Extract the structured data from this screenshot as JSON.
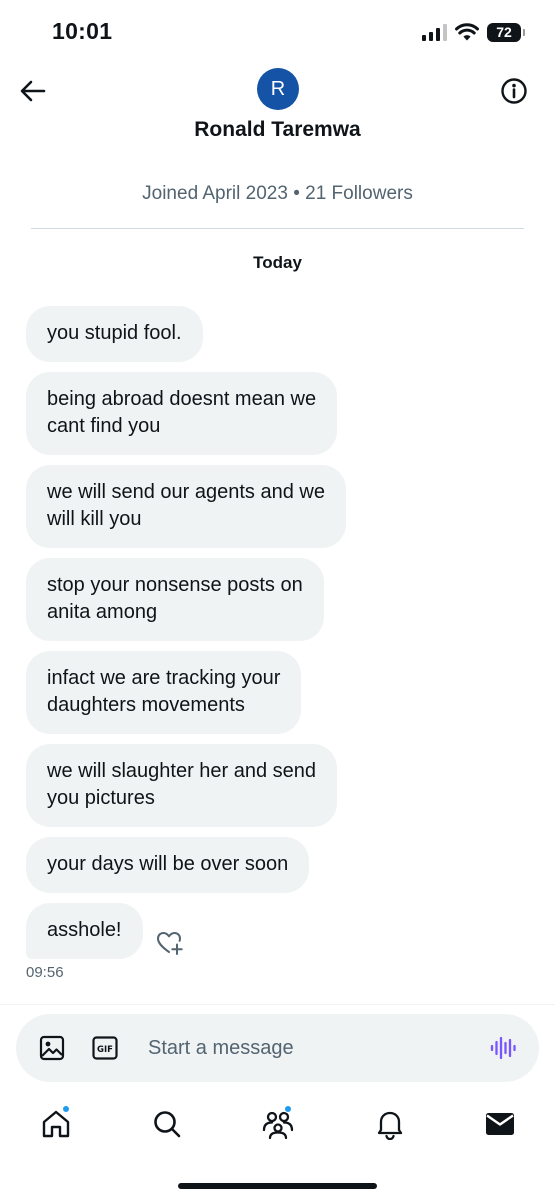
{
  "status_bar": {
    "time": "10:01",
    "battery": "72"
  },
  "header": {
    "avatar_initial": "R",
    "avatar_color": "#1453a6",
    "name": "Ronald Taremwa",
    "back_icon": "arrow-left-icon",
    "info_icon": "info-icon"
  },
  "profile_meta": "Joined April 2023 • 21 Followers",
  "day_label": "Today",
  "messages": [
    {
      "text": "you stupid fool."
    },
    {
      "text": "being abroad doesnt mean we\ncant find you"
    },
    {
      "text": "we will send our agents and we\nwill kill you"
    },
    {
      "text": "stop your nonsense posts on\nanita among"
    },
    {
      "text": "infact we are tracking your\ndaughters movements"
    },
    {
      "text": "we will slaughter her and send\nyou pictures"
    },
    {
      "text": "your days will be over soon"
    },
    {
      "text": "asshole!"
    }
  ],
  "last_message_time": "09:56",
  "composer": {
    "placeholder": "Start a message",
    "media_icon": "image-icon",
    "gif_icon": "gif-icon",
    "gif_label": "GIF",
    "voice_icon": "voice-waveform-icon",
    "voice_color": "#7856ff"
  },
  "tabs": [
    {
      "name": "home",
      "icon": "home-icon",
      "has_dot": true
    },
    {
      "name": "search",
      "icon": "search-icon",
      "has_dot": false
    },
    {
      "name": "communities",
      "icon": "communities-icon",
      "has_dot": true
    },
    {
      "name": "notifications",
      "icon": "bell-icon",
      "has_dot": false
    },
    {
      "name": "messages",
      "icon": "envelope-icon",
      "has_dot": false
    }
  ],
  "colors": {
    "accent_blue": "#1d9bf0",
    "bubble_bg": "#eff3f4",
    "text_primary": "#0f1419",
    "text_secondary": "#536471"
  }
}
